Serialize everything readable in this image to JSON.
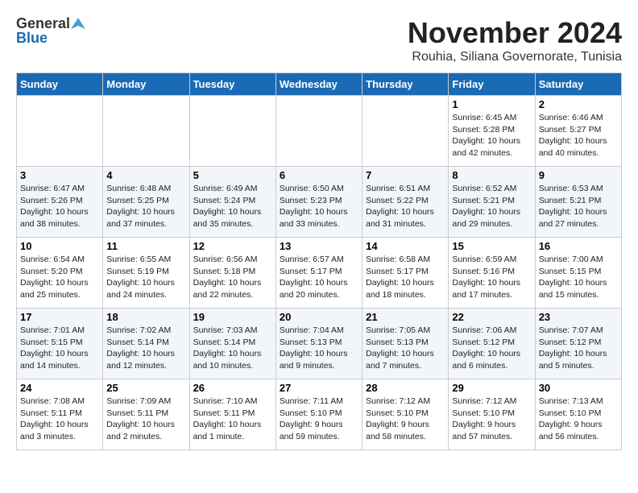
{
  "header": {
    "logo_general": "General",
    "logo_blue": "Blue",
    "month": "November 2024",
    "location": "Rouhia, Siliana Governorate, Tunisia"
  },
  "weekdays": [
    "Sunday",
    "Monday",
    "Tuesday",
    "Wednesday",
    "Thursday",
    "Friday",
    "Saturday"
  ],
  "weeks": [
    [
      {
        "day": "",
        "info": ""
      },
      {
        "day": "",
        "info": ""
      },
      {
        "day": "",
        "info": ""
      },
      {
        "day": "",
        "info": ""
      },
      {
        "day": "",
        "info": ""
      },
      {
        "day": "1",
        "info": "Sunrise: 6:45 AM\nSunset: 5:28 PM\nDaylight: 10 hours and 42 minutes."
      },
      {
        "day": "2",
        "info": "Sunrise: 6:46 AM\nSunset: 5:27 PM\nDaylight: 10 hours and 40 minutes."
      }
    ],
    [
      {
        "day": "3",
        "info": "Sunrise: 6:47 AM\nSunset: 5:26 PM\nDaylight: 10 hours and 38 minutes."
      },
      {
        "day": "4",
        "info": "Sunrise: 6:48 AM\nSunset: 5:25 PM\nDaylight: 10 hours and 37 minutes."
      },
      {
        "day": "5",
        "info": "Sunrise: 6:49 AM\nSunset: 5:24 PM\nDaylight: 10 hours and 35 minutes."
      },
      {
        "day": "6",
        "info": "Sunrise: 6:50 AM\nSunset: 5:23 PM\nDaylight: 10 hours and 33 minutes."
      },
      {
        "day": "7",
        "info": "Sunrise: 6:51 AM\nSunset: 5:22 PM\nDaylight: 10 hours and 31 minutes."
      },
      {
        "day": "8",
        "info": "Sunrise: 6:52 AM\nSunset: 5:21 PM\nDaylight: 10 hours and 29 minutes."
      },
      {
        "day": "9",
        "info": "Sunrise: 6:53 AM\nSunset: 5:21 PM\nDaylight: 10 hours and 27 minutes."
      }
    ],
    [
      {
        "day": "10",
        "info": "Sunrise: 6:54 AM\nSunset: 5:20 PM\nDaylight: 10 hours and 25 minutes."
      },
      {
        "day": "11",
        "info": "Sunrise: 6:55 AM\nSunset: 5:19 PM\nDaylight: 10 hours and 24 minutes."
      },
      {
        "day": "12",
        "info": "Sunrise: 6:56 AM\nSunset: 5:18 PM\nDaylight: 10 hours and 22 minutes."
      },
      {
        "day": "13",
        "info": "Sunrise: 6:57 AM\nSunset: 5:17 PM\nDaylight: 10 hours and 20 minutes."
      },
      {
        "day": "14",
        "info": "Sunrise: 6:58 AM\nSunset: 5:17 PM\nDaylight: 10 hours and 18 minutes."
      },
      {
        "day": "15",
        "info": "Sunrise: 6:59 AM\nSunset: 5:16 PM\nDaylight: 10 hours and 17 minutes."
      },
      {
        "day": "16",
        "info": "Sunrise: 7:00 AM\nSunset: 5:15 PM\nDaylight: 10 hours and 15 minutes."
      }
    ],
    [
      {
        "day": "17",
        "info": "Sunrise: 7:01 AM\nSunset: 5:15 PM\nDaylight: 10 hours and 14 minutes."
      },
      {
        "day": "18",
        "info": "Sunrise: 7:02 AM\nSunset: 5:14 PM\nDaylight: 10 hours and 12 minutes."
      },
      {
        "day": "19",
        "info": "Sunrise: 7:03 AM\nSunset: 5:14 PM\nDaylight: 10 hours and 10 minutes."
      },
      {
        "day": "20",
        "info": "Sunrise: 7:04 AM\nSunset: 5:13 PM\nDaylight: 10 hours and 9 minutes."
      },
      {
        "day": "21",
        "info": "Sunrise: 7:05 AM\nSunset: 5:13 PM\nDaylight: 10 hours and 7 minutes."
      },
      {
        "day": "22",
        "info": "Sunrise: 7:06 AM\nSunset: 5:12 PM\nDaylight: 10 hours and 6 minutes."
      },
      {
        "day": "23",
        "info": "Sunrise: 7:07 AM\nSunset: 5:12 PM\nDaylight: 10 hours and 5 minutes."
      }
    ],
    [
      {
        "day": "24",
        "info": "Sunrise: 7:08 AM\nSunset: 5:11 PM\nDaylight: 10 hours and 3 minutes."
      },
      {
        "day": "25",
        "info": "Sunrise: 7:09 AM\nSunset: 5:11 PM\nDaylight: 10 hours and 2 minutes."
      },
      {
        "day": "26",
        "info": "Sunrise: 7:10 AM\nSunset: 5:11 PM\nDaylight: 10 hours and 1 minute."
      },
      {
        "day": "27",
        "info": "Sunrise: 7:11 AM\nSunset: 5:10 PM\nDaylight: 9 hours and 59 minutes."
      },
      {
        "day": "28",
        "info": "Sunrise: 7:12 AM\nSunset: 5:10 PM\nDaylight: 9 hours and 58 minutes."
      },
      {
        "day": "29",
        "info": "Sunrise: 7:12 AM\nSunset: 5:10 PM\nDaylight: 9 hours and 57 minutes."
      },
      {
        "day": "30",
        "info": "Sunrise: 7:13 AM\nSunset: 5:10 PM\nDaylight: 9 hours and 56 minutes."
      }
    ]
  ]
}
